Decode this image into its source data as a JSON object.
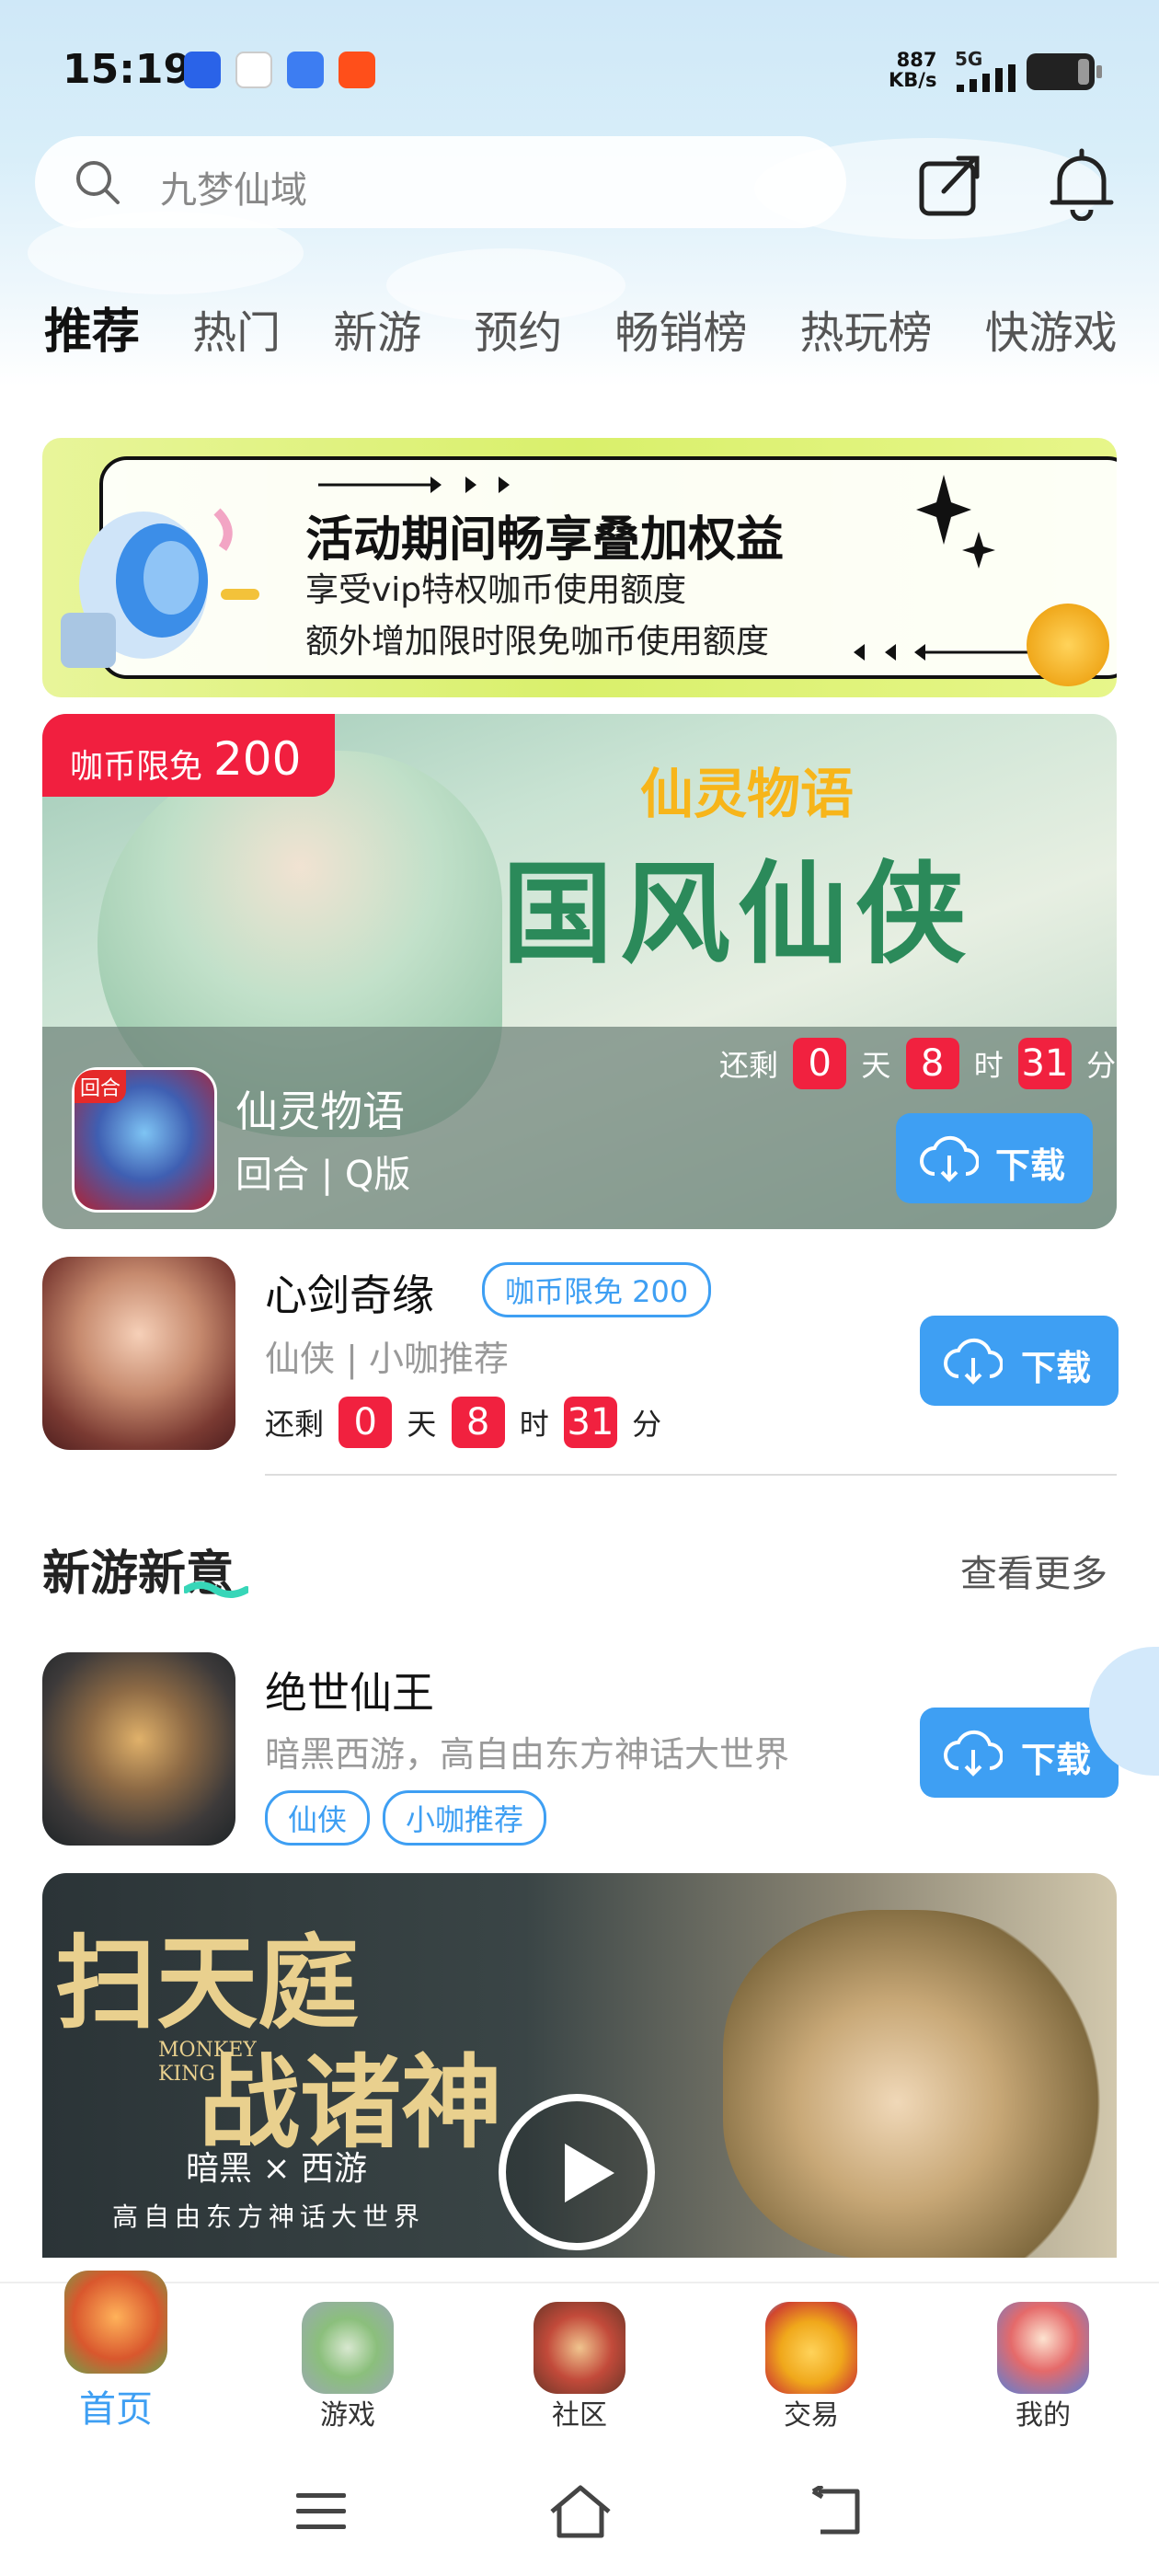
{
  "status_bar": {
    "time": "15:19",
    "net_speed": "887",
    "net_unit": "KB/s",
    "network": "5G",
    "app_icons": [
      "baidu-icon",
      "du-icon",
      "browser-icon",
      "taobao-icon"
    ]
  },
  "search": {
    "placeholder": "九梦仙域"
  },
  "header_icons": [
    "share-icon",
    "bell-icon"
  ],
  "tabs": [
    {
      "label": "推荐",
      "active": true
    },
    {
      "label": "热门"
    },
    {
      "label": "新游"
    },
    {
      "label": "预约"
    },
    {
      "label": "畅销榜"
    },
    {
      "label": "热玩榜"
    },
    {
      "label": "快游戏"
    }
  ],
  "promo_banner": {
    "title": "活动期间畅享叠加权益",
    "line1": "享受vip特权咖币使用额度",
    "line2": "额外增加限时限免咖币使用额度"
  },
  "featured": {
    "tag_text": "咖币限免",
    "tag_value": "200",
    "art_logo": "仙灵物语",
    "art_title": "国风仙侠",
    "icon_tag": "回合",
    "name": "仙灵物语",
    "genre": "回合 | Q版",
    "countdown": {
      "prefix": "还剩",
      "days": "0",
      "days_unit": "天",
      "hours": "8",
      "hours_unit": "时",
      "minutes": "31",
      "minutes_unit": "分"
    },
    "download_label": "下载"
  },
  "game_row_1": {
    "name": "心剑奇缘",
    "badge": "咖币限免 200",
    "desc": "仙侠 | 小咖推荐",
    "countdown": {
      "prefix": "还剩",
      "days": "0",
      "days_unit": "天",
      "hours": "8",
      "hours_unit": "时",
      "minutes": "31",
      "minutes_unit": "分"
    },
    "download_label": "下载"
  },
  "section": {
    "title": "新游新意",
    "more": "查看更多"
  },
  "game_row_2": {
    "name": "绝世仙王",
    "desc": "暗黑西游，高自由东方神话大世界",
    "tags": [
      "仙侠",
      "小咖推荐"
    ],
    "download_label": "下载"
  },
  "video_banner": {
    "title_line1": "扫天庭",
    "title_line2": "战诸神",
    "mk_line1": "MONKEY",
    "mk_line2": "KING",
    "sub1": "暗黑 × 西游",
    "sub2": "高自由东方神话大世界"
  },
  "bottom_nav": [
    {
      "label": "首页",
      "icon": "home-gate-icon",
      "active": true
    },
    {
      "label": "游戏",
      "icon": "floating-island-icon"
    },
    {
      "label": "社区",
      "icon": "community-treasure-icon"
    },
    {
      "label": "交易",
      "icon": "money-bag-icon"
    },
    {
      "label": "我的",
      "icon": "avatar-character-icon"
    }
  ],
  "system_nav": [
    "menu-icon",
    "home-icon",
    "back-icon"
  ],
  "colors": {
    "accent": "#3e9ff3",
    "badge_red": "#f1213f"
  }
}
